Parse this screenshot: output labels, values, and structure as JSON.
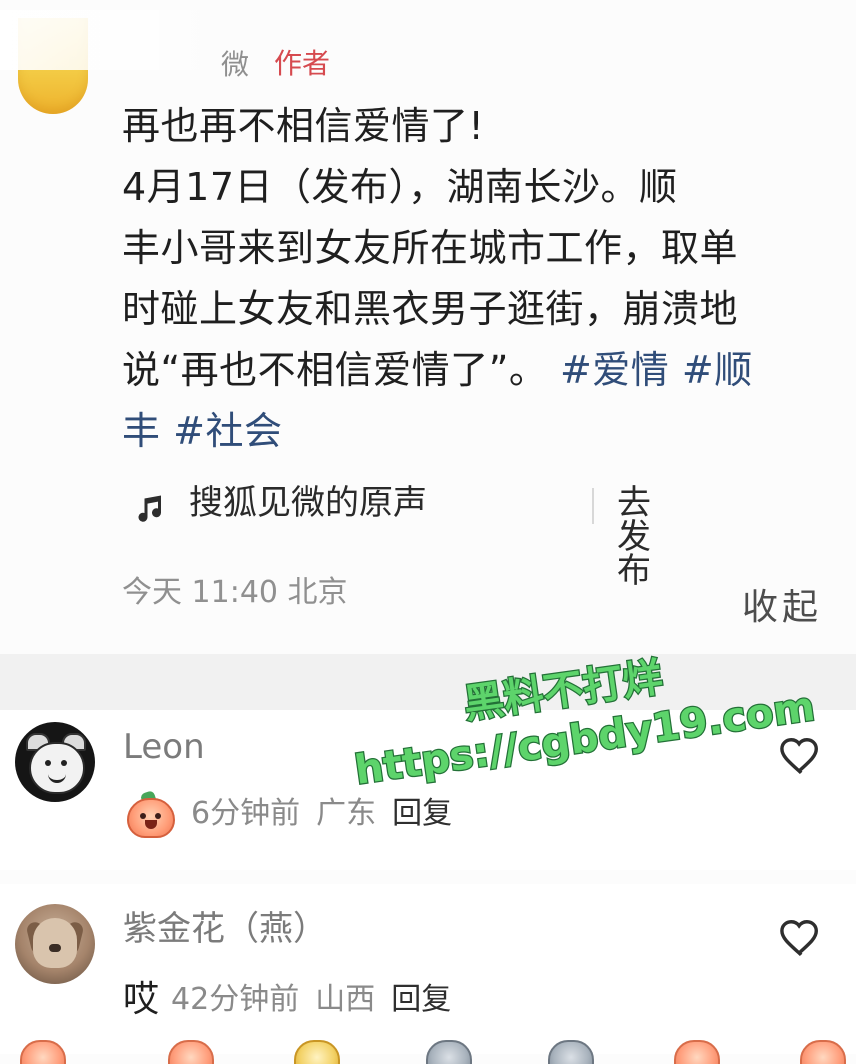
{
  "post": {
    "author_name": "微",
    "author_badge": "作者",
    "body_lines": [
      "再也再不相信爱情了!",
      "4月17日（发布），湖南长沙。顺",
      "丰小哥来到女友所在城市工作，取单",
      "时碰上女友和黑衣男子逛街，崩溃地",
      "说“再也不相信爱情了”。",
      "丰"
    ],
    "hashtags_line4": [
      "#爱情",
      "#顺"
    ],
    "hashtags_line5": [
      "#社会"
    ],
    "audio_title": "搜狐见微的原声",
    "audio_action": "去发布",
    "meta": "今天 11:40 北京",
    "collapse": "收起"
  },
  "watermark": {
    "line1": "黑料不打烊",
    "line2": "https://cgbdy19.com",
    "color": "#5dd46b"
  },
  "comments": [
    {
      "name": "Leon",
      "time": "6分钟前",
      "location": "广东",
      "reply": "回复",
      "emoji": "emoji-peach-face-icon"
    },
    {
      "name": "紫金花（燕）",
      "text": "哎",
      "time": "42分钟前",
      "location": "山西",
      "reply": "回复"
    }
  ],
  "colors": {
    "hashtag": "#304d79",
    "author_badge": "#d64a4f",
    "muted_text": "#8a8a8a"
  }
}
